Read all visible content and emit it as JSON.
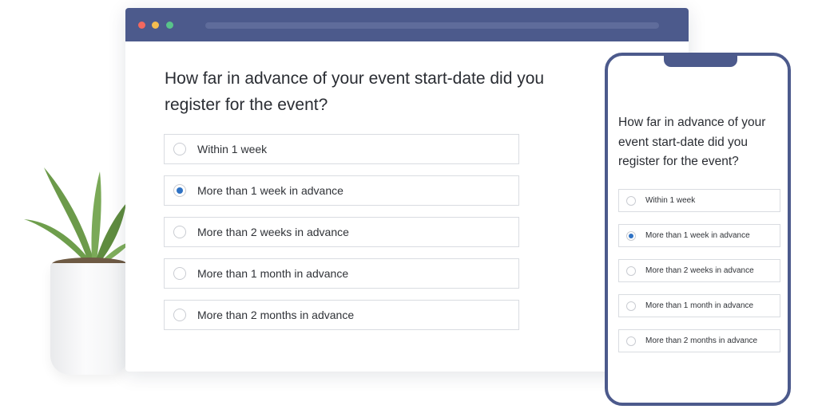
{
  "survey": {
    "question": "How far in advance of your event start-date did you register for the event?",
    "options": [
      {
        "label": "Within 1 week",
        "selected": false
      },
      {
        "label": "More than 1 week in advance",
        "selected": true
      },
      {
        "label": "More than 2 weeks in advance",
        "selected": false
      },
      {
        "label": "More than 1 month in advance",
        "selected": false
      },
      {
        "label": "More than 2 months in advance",
        "selected": false
      }
    ]
  },
  "mobile": {
    "question": "How far in advance of your event start-date did you register for the event?",
    "options": [
      {
        "label": "Within 1 week",
        "selected": false
      },
      {
        "label": "More than 1 week in advance",
        "selected": true
      },
      {
        "label": "More than 2 weeks in advance",
        "selected": false
      },
      {
        "label": "More than 1 month in advance",
        "selected": false
      },
      {
        "label": "More than 2 months in advance",
        "selected": false
      }
    ]
  },
  "colors": {
    "brand": "#4c5a8c",
    "radio_selected": "#2f72c4",
    "window_red": "#f2685f",
    "window_yellow": "#f4bd4f",
    "window_green": "#58c48a"
  },
  "icons": {
    "plant": "plant-illustration",
    "radio_off": "radio-unchecked-icon",
    "radio_on": "radio-checked-icon"
  }
}
